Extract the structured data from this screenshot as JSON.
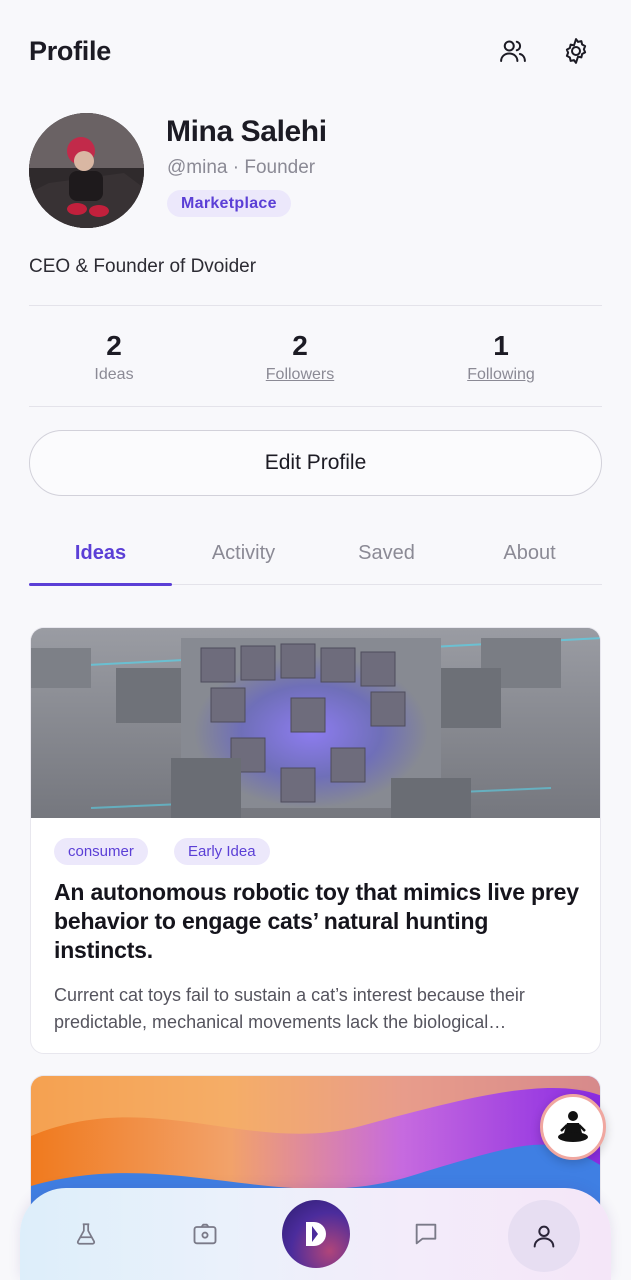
{
  "header": {
    "title": "Profile",
    "people_icon": "people-icon",
    "settings_icon": "gear-icon"
  },
  "profile": {
    "name": "Mina Salehi",
    "handle": "@mina · Founder",
    "badge": "Marketplace",
    "bio": "CEO & Founder of Dvoider"
  },
  "stats": [
    {
      "value": "2",
      "label": "Ideas"
    },
    {
      "value": "2",
      "label": "Followers"
    },
    {
      "value": "1",
      "label": "Following"
    }
  ],
  "edit_button": "Edit Profile",
  "tabs": [
    {
      "label": "Ideas",
      "active": true
    },
    {
      "label": "Activity",
      "active": false
    },
    {
      "label": "Saved",
      "active": false
    },
    {
      "label": "About",
      "active": false
    }
  ],
  "cards": [
    {
      "tags": [
        "consumer",
        "Early Idea"
      ],
      "title": "An autonomous robotic toy that mimics live prey behavior to engage cats’ natural hunting instincts.",
      "description": "Current cat toys fail to sustain a cat’s interest because their predictable, mechanical movements lack the biological…"
    }
  ],
  "bottom_nav": {
    "items": [
      "flask-icon",
      "camera-icon",
      "dvoider-logo-icon",
      "chat-icon",
      "user-icon"
    ],
    "active": "user-icon"
  },
  "colors": {
    "accent": "#5b3fd6",
    "badge_bg": "#ece8fb",
    "muted_text": "#8b8a95",
    "background": "#f8f8fb"
  }
}
